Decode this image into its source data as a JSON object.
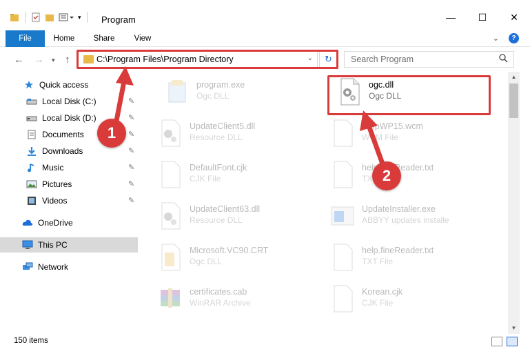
{
  "window": {
    "title": "Program",
    "controls": {
      "minimize": "—",
      "maximize": "☐",
      "close": "✕"
    }
  },
  "ribbon": {
    "tabs": [
      "File",
      "Home",
      "Share",
      "View"
    ],
    "help": "?"
  },
  "address_bar": {
    "path": "C:\\Program Files\\Program Directory",
    "dropdown": "⌄",
    "refresh": "↻"
  },
  "search": {
    "placeholder": "Search Program",
    "icon": "🔍"
  },
  "sidebar": {
    "items": [
      {
        "label": "Quick access",
        "icon": "star-icon",
        "pinned": false
      },
      {
        "label": "Local Disk (C:)",
        "icon": "drive-icon",
        "pinned": true
      },
      {
        "label": "Local Disk (D:)",
        "icon": "drive-icon",
        "pinned": true
      },
      {
        "label": "Documents",
        "icon": "documents-icon",
        "pinned": true
      },
      {
        "label": "Downloads",
        "icon": "download-icon",
        "pinned": true
      },
      {
        "label": "Music",
        "icon": "music-icon",
        "pinned": true
      },
      {
        "label": "Pictures",
        "icon": "pictures-icon",
        "pinned": true
      },
      {
        "label": "Videos",
        "icon": "videos-icon",
        "pinned": true
      },
      {
        "label": "OneDrive",
        "icon": "cloud-icon",
        "pinned": false
      },
      {
        "label": "This PC",
        "icon": "computer-icon",
        "pinned": false
      },
      {
        "label": "Network",
        "icon": "network-icon",
        "pinned": false
      }
    ],
    "pin_glyph": "📌"
  },
  "files": [
    {
      "name": "program.exe",
      "type": "Ogc DLL",
      "icon": "exe-icon",
      "faded": true
    },
    {
      "name": "ogc.dll",
      "type": "Ogc DLL",
      "icon": "dll-gear-icon",
      "faded": false
    },
    {
      "name": "UpdateClient5.dll",
      "type": "Resource DLL",
      "icon": "dll-gear-icon",
      "faded": true
    },
    {
      "name": "HelpWP15.wcm",
      "type": "WCM File",
      "icon": "blank-file-icon",
      "faded": true
    },
    {
      "name": "DefaultFont.cjk",
      "type": "CJK File",
      "icon": "blank-file-icon",
      "faded": true
    },
    {
      "name": "help.fineReader.txt",
      "type": "TXT File",
      "icon": "blank-file-icon",
      "faded": true
    },
    {
      "name": "UpdateClient63.dll",
      "type": "Resource DLL",
      "icon": "dll-gear-icon",
      "faded": true
    },
    {
      "name": "UpdateInstaller.exe",
      "type": "ABBYY updates installe",
      "icon": "installer-icon",
      "faded": true
    },
    {
      "name": "Microsoft.VC90.CRT",
      "type": "Ogc DLL",
      "icon": "folder-file-icon",
      "faded": true
    },
    {
      "name": "help.fineReader.txt",
      "type": "TXT File",
      "icon": "blank-file-icon",
      "faded": true
    },
    {
      "name": "certificates.cab",
      "type": "WinRAR Archive",
      "icon": "archive-icon",
      "faded": true
    },
    {
      "name": "Korean.cjk",
      "type": "CJK File",
      "icon": "blank-file-icon",
      "faded": true
    }
  ],
  "status_bar": {
    "item_count": "150 items"
  },
  "annotations": {
    "step1": "1",
    "step2": "2",
    "color": "#d93b3b"
  },
  "colors": {
    "accent": "#1979ca",
    "folder": "#e8b948",
    "selected": "#d9d9d9"
  }
}
